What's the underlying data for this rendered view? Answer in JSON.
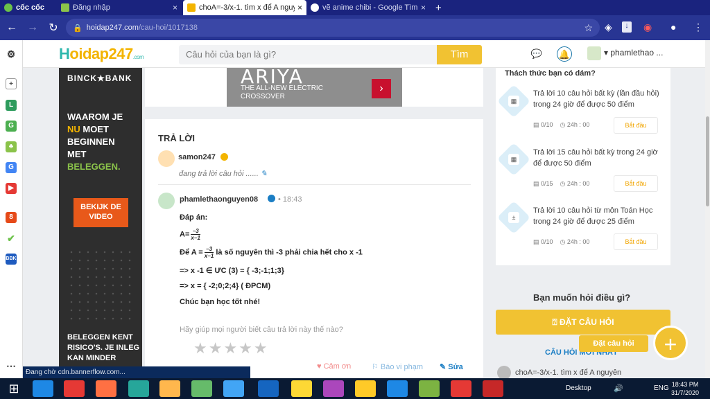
{
  "browser": {
    "app_label": "cốc cốc",
    "tabs": [
      {
        "title": "Đăng nhập",
        "close": "×"
      },
      {
        "title": "choA=-3/x-1. tìm x để A nguy…",
        "close": "×"
      },
      {
        "title": "vẽ anime chibi - Google Tìm …",
        "close": "×"
      }
    ],
    "new_tab": "+",
    "url_host": "hoidap247.com",
    "url_path": "/cau-hoi/1017138"
  },
  "site": {
    "logo_first": "H",
    "logo_rest": "oidap247",
    "logo_domain": ".com",
    "search_placeholder": "Câu hỏi của bạn là gì?",
    "search_button": "Tìm",
    "username": "phamlethao ..."
  },
  "ad": {
    "brand": "BINCK★BANK",
    "headline_1": "WAAROM JE",
    "headline_2": "NU",
    "headline_3": " MOET",
    "headline_4": "BEGINNEN",
    "headline_5": "MET",
    "headline_6": "BELEGGEN.",
    "cta": "BEKIJK DE VIDEO",
    "footer": "BELEGGEN KENT RISICO'S. JE INLEG KAN MINDER"
  },
  "banner": {
    "title": "ARIYA",
    "line1": "THE ALL-NEW ELECTRIC",
    "line2": "CROSSOVER",
    "arrow": "›"
  },
  "answer": {
    "heading": "TRẢ LỜI",
    "answerer1": "samon247",
    "pending": "đang trả lời câu hỏi ......",
    "answerer2": "phamlethaonguyen08",
    "time": "18:43",
    "line_label": "Đáp án:",
    "line_a": "A=",
    "frac_num": "−3",
    "frac_den": "x−1",
    "line_b_pre": "Để A =",
    "line_b_post": " là số nguyên thì  -3 phải chia hết cho x -1",
    "line_c": "=> x -1   ∈ ƯC (3) = { -3;-1;1;3}",
    "line_d": "=> x = { -2;0;2;4} ( ĐPCM)",
    "line_e": "Chúc bạn học tốt nhé!",
    "ask_rate": "Hãy giúp mọi người biết câu trả lời này thế nào?",
    "stars": "★★★★★",
    "thanks": "♥ Cảm ơn",
    "report": "⚐ Báo vi phạm",
    "edit": "✎ Sửa"
  },
  "challenge": {
    "title": "Thách thức bạn có dám?",
    "items": [
      {
        "text": "Trả lời 10 câu hỏi  bất kỳ (lần đầu hỏi) trong 24 giờ để được 50 điểm",
        "progress": "0/10",
        "time": "24h : 00",
        "button": "Bắt đầu"
      },
      {
        "text": "Trả lời 15 câu hỏi  bất kỳ  trong 24 giờ để được 50 điểm",
        "progress": "0/15",
        "time": "24h : 00",
        "button": "Bắt đầu"
      },
      {
        "text": "Trả lời 10 câu hỏi  từ môn Toán Học trong 24 giờ để được 25 điểm",
        "progress": "0/10",
        "time": "24h : 00",
        "button": "Bắt đầu"
      }
    ]
  },
  "ask": {
    "heading": "Bạn muốn hỏi điều gì?",
    "button": "ĐẶT CÂU HỎI",
    "new_questions": "CÂU HỎI MỚI NHẤT",
    "fab_tip": "Đặt câu hỏi",
    "fab": "+",
    "recent": "choA=-3/x-1. tìm x để A nguyên"
  },
  "status": "Đang chờ cdn.bannerflow.com...",
  "taskbar": {
    "desktop": "Desktop",
    "lang": "ENG",
    "time": "18:43 PM",
    "date": "31/7/2020"
  },
  "colors": {
    "accent": "#f1c232",
    "brand_teal": "#2db7ad",
    "browser": "#283593"
  }
}
